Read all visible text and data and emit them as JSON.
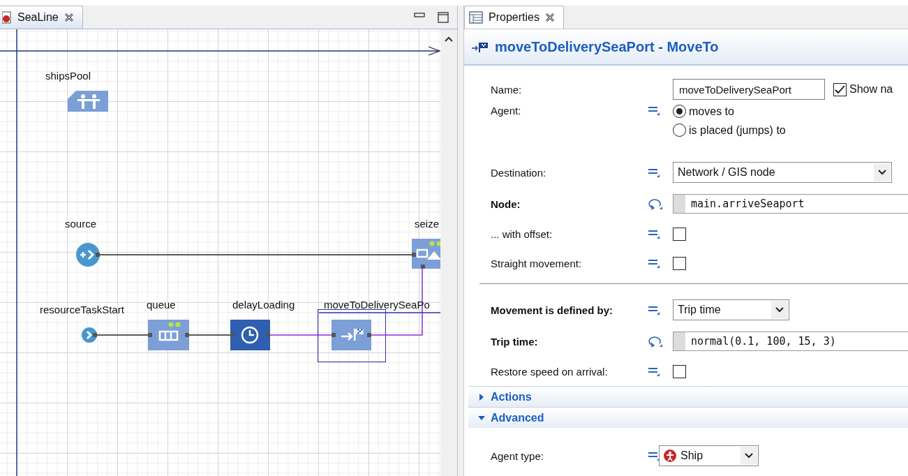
{
  "editor_tab": {
    "title": "SeaLine",
    "selected": true
  },
  "diagram": {
    "nodes": [
      {
        "kind": "resource_pool",
        "label": "shipsPool",
        "selected": false
      },
      {
        "kind": "source",
        "label": "source",
        "selected": false
      },
      {
        "kind": "seize",
        "label": "seize",
        "selected": false
      },
      {
        "kind": "enter",
        "label": "resourceTaskStart",
        "selected": false
      },
      {
        "kind": "queue",
        "label": "queue",
        "selected": false
      },
      {
        "kind": "delay",
        "label": "delayLoading",
        "selected": false
      },
      {
        "kind": "move_to",
        "label": "moveToDeliverySeaPo",
        "selected": true
      }
    ]
  },
  "properties_tab": {
    "title": "Properties",
    "selected": true
  },
  "properties": {
    "title": "moveToDeliverySeaPort - MoveTo",
    "fields": [
      {
        "kind": "text",
        "label": "Name:",
        "bold": false,
        "value": "moveToDeliverySeaPort",
        "checkbox": {
          "label": "Show na",
          "checked": true
        }
      },
      {
        "kind": "radio",
        "label": "Agent:",
        "bold": false,
        "options": [
          {
            "label": "moves to",
            "selected": true
          },
          {
            "label": "is placed (jumps) to",
            "selected": false
          }
        ]
      },
      {
        "kind": "dropdown",
        "label": "Destination:",
        "bold": false,
        "value": "Network / GIS node"
      },
      {
        "kind": "code",
        "label": "Node:",
        "bold": true,
        "value": "main.arriveSeaport"
      },
      {
        "kind": "checkbox",
        "label": "... with offset:",
        "bold": false,
        "checked": false
      },
      {
        "kind": "checkbox",
        "label": "Straight movement:",
        "bold": false,
        "checked": false
      },
      {
        "kind": "divider"
      },
      {
        "kind": "compact_dropdown",
        "label": "Movement is defined by:",
        "bold": true,
        "value": "Trip time"
      },
      {
        "kind": "code",
        "label": "Trip time:",
        "bold": true,
        "value": "normal(0.1, 100, 15, 3)"
      },
      {
        "kind": "checkbox",
        "label": "Restore speed on arrival:",
        "bold": false,
        "checked": false
      }
    ],
    "sections": [
      {
        "title": "Actions",
        "expanded": false
      },
      {
        "title": "Advanced",
        "expanded": true,
        "fields": [
          {
            "kind": "agent_dropdown",
            "label": "Agent type:",
            "bold": false,
            "value": "Ship"
          }
        ]
      }
    ]
  }
}
